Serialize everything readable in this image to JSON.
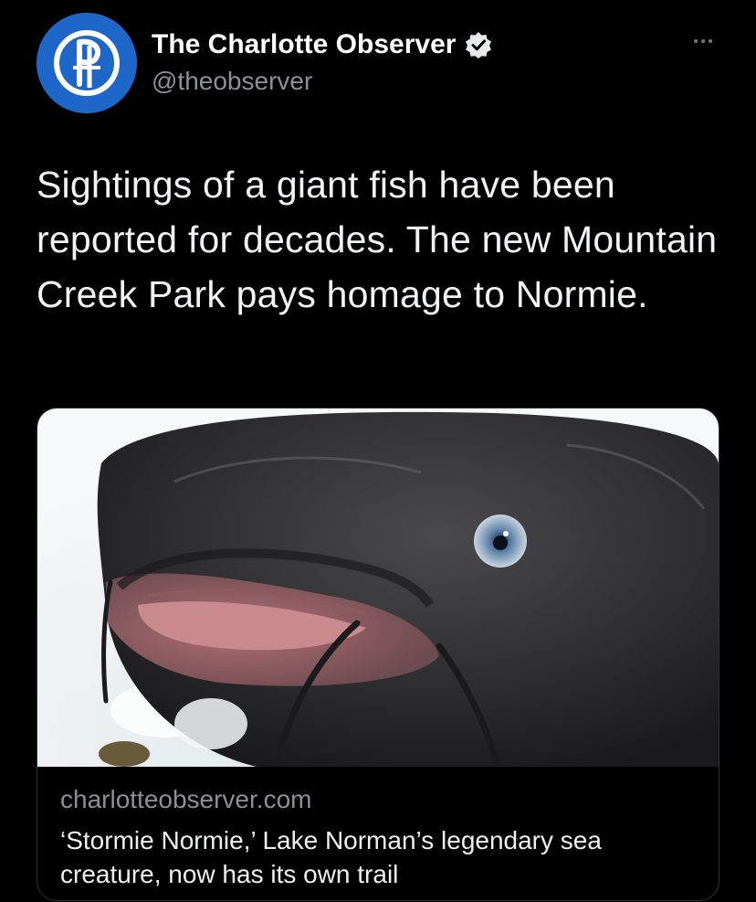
{
  "tweet": {
    "display_name": "The Charlotte Observer",
    "handle": "@theobserver",
    "verified_icon": "verified-badge-icon",
    "more_icon": "more-options-icon",
    "text": "Sightings of a giant fish have been reported for decades. The new Mountain Creek Park pays homage to Normie."
  },
  "card": {
    "domain": "charlotteobserver.com",
    "title": "‘Stormie Normie,’ Lake Norman’s legendary sea creature, now has its own trail",
    "image": "catfish-on-ice-photo"
  },
  "colors": {
    "background": "#000000",
    "avatar_blue": "#1e67c8",
    "secondary_text": "#8b9197",
    "border": "#2f3336"
  }
}
